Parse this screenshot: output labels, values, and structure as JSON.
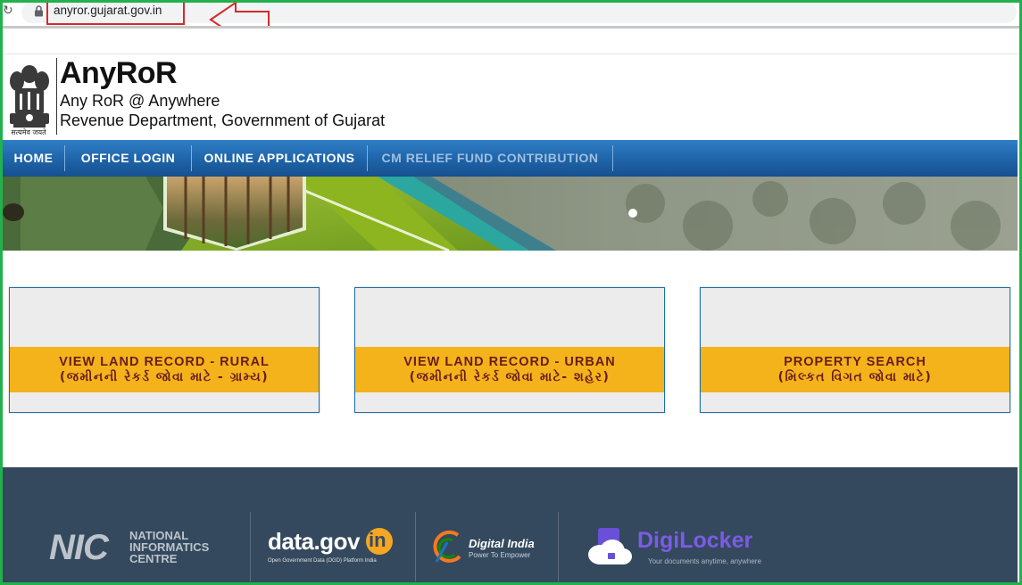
{
  "browser": {
    "url": "anyror.gujarat.gov.in"
  },
  "header": {
    "emblem_motto": "सत्यमेव जयते",
    "title": "AnyRoR",
    "subtitle": "Any RoR @ Anywhere",
    "department": "Revenue Department, Government of Gujarat"
  },
  "nav": {
    "items": [
      {
        "label": "HOME"
      },
      {
        "label": "OFFICE LOGIN"
      },
      {
        "label": "ONLINE APPLICATIONS"
      },
      {
        "label": "CM RELIEF FUND CONTRIBUTION"
      }
    ]
  },
  "cards": [
    {
      "title": "VIEW LAND RECORD - RURAL",
      "subtitle": "(જમીનની રેકર્ડ જોવા માટે - ગ્રામ્ય)"
    },
    {
      "title": "VIEW LAND RECORD - URBAN",
      "subtitle": "(જમીનની રેકર્ડ જોવા માટે- શહેર)"
    },
    {
      "title": "PROPERTY SEARCH",
      "subtitle": "(મિલ્કત વિગત જોવા માટે)"
    }
  ],
  "footer": {
    "nic": {
      "line1": "NATIONAL",
      "line2": "INFORMATICS",
      "line3": "CENTRE",
      "mark": "NIC"
    },
    "datagov": {
      "name": "data.gov",
      "suffix": "in",
      "tagline": "Open Government Data (OGD) Platform India"
    },
    "digital_india": {
      "name": "Digital India",
      "tagline": "Power To Empower"
    },
    "digilocker": {
      "name": "DigiLocker",
      "tagline": "Your documents anytime, anywhere"
    }
  },
  "colors": {
    "frame": "#22b14c",
    "url_highlight": "#d42a2a",
    "nav": "#1e63a8",
    "card_band": "#f4b31a",
    "card_text": "#6a1c1c",
    "footer": "#34495e"
  }
}
